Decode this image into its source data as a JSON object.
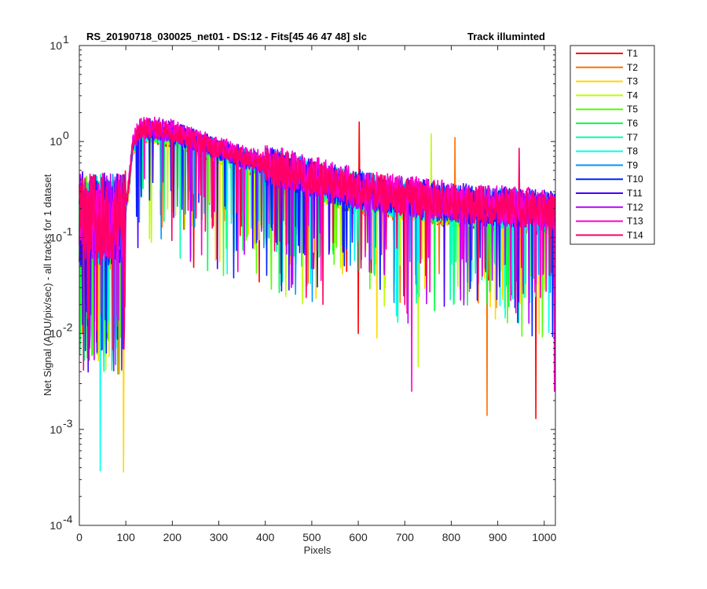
{
  "chart_data": {
    "type": "line",
    "title_left": "RS_20190718_030025_net01 - DS:12 - Fits[45  46  47  48]   slc",
    "title_right": "Track illuminted",
    "xlabel": "Pixels",
    "ylabel": "Net Signal (ADU/pix/sec) - all tracks for 1 dataset",
    "xlim": [
      0,
      1024
    ],
    "ylim": [
      0.0001,
      10
    ],
    "yscale": "log",
    "grid": false,
    "legend_position": "outside-right-top",
    "xticks": [
      0,
      100,
      200,
      300,
      400,
      500,
      600,
      700,
      800,
      900,
      1000
    ],
    "xtick_labels": [
      "0",
      "100",
      "200",
      "300",
      "400",
      "500",
      "600",
      "700",
      "800",
      "900",
      "1000"
    ],
    "yticks": [
      0.0001,
      0.001,
      0.01,
      0.1,
      1,
      10
    ],
    "ytick_labels": [
      {
        "base": "10",
        "exp": "-4"
      },
      {
        "base": "10",
        "exp": "-3"
      },
      {
        "base": "10",
        "exp": "-2"
      },
      {
        "base": "10",
        "exp": "-1"
      },
      {
        "base": "10",
        "exp": "0"
      },
      {
        "base": "10",
        "exp": "1"
      }
    ],
    "series": [
      {
        "name": "T1",
        "color": "#ff0000"
      },
      {
        "name": "T2",
        "color": "#ff7000"
      },
      {
        "name": "T3",
        "color": "#ffd900"
      },
      {
        "name": "T4",
        "color": "#bbff00"
      },
      {
        "name": "T5",
        "color": "#55ff00"
      },
      {
        "name": "T6",
        "color": "#00ff44"
      },
      {
        "name": "T7",
        "color": "#00ffaa"
      },
      {
        "name": "T8",
        "color": "#00ffee"
      },
      {
        "name": "T9",
        "color": "#0099ff"
      },
      {
        "name": "T10",
        "color": "#0022ff"
      },
      {
        "name": "T11",
        "color": "#4400ff"
      },
      {
        "name": "T12",
        "color": "#bb00ff"
      },
      {
        "name": "T13",
        "color": "#ff00cc"
      },
      {
        "name": "T14",
        "color": "#ff0066"
      }
    ],
    "profile": {
      "description_points_x": [
        0,
        95,
        105,
        115,
        130,
        150,
        200,
        300,
        400,
        500,
        600,
        700,
        800,
        900,
        1024
      ],
      "typical_y": [
        0.15,
        0.15,
        0.3,
        0.9,
        1.25,
        1.3,
        1.2,
        0.8,
        0.55,
        0.4,
        0.3,
        0.25,
        0.22,
        0.2,
        0.18
      ]
    },
    "notable_points": [
      {
        "series": "T8",
        "x": 45,
        "y": 0.00037
      },
      {
        "series": "T3",
        "x": 95,
        "y": 0.00036
      },
      {
        "series": "T1",
        "x": 602,
        "y": 1.6
      },
      {
        "series": "T1",
        "x": 600,
        "y": 0.01
      },
      {
        "series": "T3",
        "x": 640,
        "y": 0.009
      },
      {
        "series": "T4",
        "x": 757,
        "y": 1.2
      },
      {
        "series": "T4",
        "x": 729,
        "y": 0.0045
      },
      {
        "series": "T2",
        "x": 808,
        "y": 1.1
      },
      {
        "series": "T2",
        "x": 877,
        "y": 0.0014
      },
      {
        "series": "T13",
        "x": 715,
        "y": 0.0025
      },
      {
        "series": "T14",
        "x": 946,
        "y": 0.85
      },
      {
        "series": "T1",
        "x": 982,
        "y": 0.0013
      },
      {
        "series": "T13",
        "x": 1022,
        "y": 0.0025
      }
    ]
  }
}
